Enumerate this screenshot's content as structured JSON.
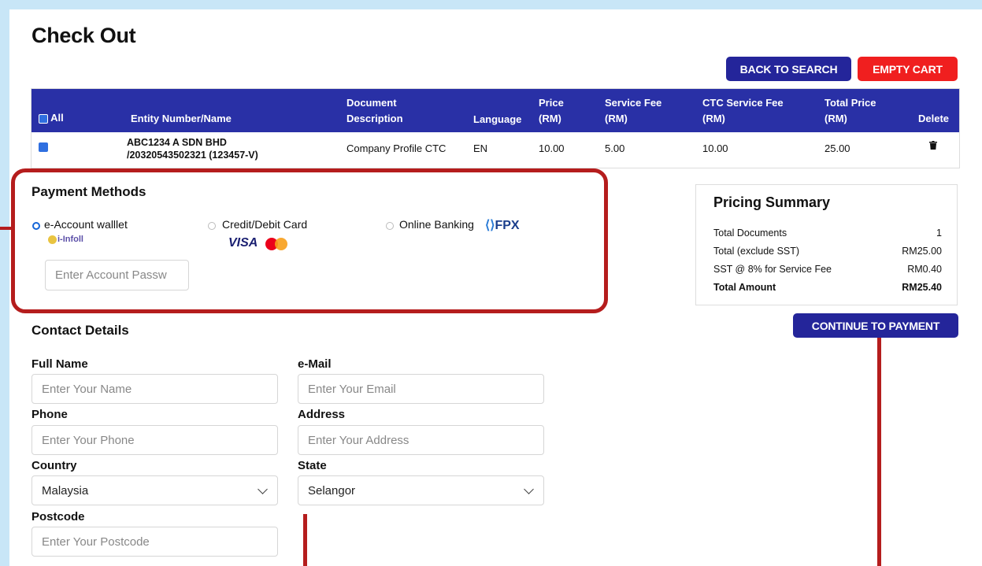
{
  "page": {
    "title": "Check Out"
  },
  "actions": {
    "back_label": "BACK TO SEARCH",
    "empty_label": "EMPTY CART",
    "continue_label": "CONTINUE TO PAYMENT"
  },
  "table": {
    "headers": {
      "all": "All",
      "entity": "Entity Number/Name",
      "doc_line1": "Document",
      "doc_line2": "Description",
      "language": "Language",
      "price_line1": "Price",
      "price_line2": "(RM)",
      "fee_line1": "Service Fee",
      "fee_line2": "(RM)",
      "ctc_line1": "CTC Service Fee",
      "ctc_line2": "(RM)",
      "total_line1": "Total Price",
      "total_line2": "(RM)",
      "delete": "Delete"
    },
    "row": {
      "entity_line1": "ABC1234 A SDN BHD",
      "entity_line2": "/20320543502321 (123457-V)",
      "description": "Company Profile CTC",
      "language": "EN",
      "price": "10.00",
      "service_fee": "5.00",
      "ctc_fee": "10.00",
      "total": "25.00",
      "checked": true
    }
  },
  "payment": {
    "title": "Payment Methods",
    "options": [
      {
        "label": "e-Account walllet",
        "logo": "i-Infoll",
        "selected": true
      },
      {
        "label": "Credit/Debit Card",
        "logo": "VISA",
        "selected": false
      },
      {
        "label": "Online Banking",
        "logo": "FPX",
        "selected": false
      }
    ],
    "password_placeholder": "Enter Account Passw"
  },
  "summary": {
    "title": "Pricing Summary",
    "rows": [
      {
        "label": "Total Documents",
        "value": "1"
      },
      {
        "label": "Total (exclude SST)",
        "value": "RM25.00"
      },
      {
        "label": "SST @ 8% for Service Fee",
        "value": "RM0.40"
      },
      {
        "label": "Total Amount",
        "value": "RM25.40"
      }
    ]
  },
  "contact": {
    "title": "Contact Details",
    "full_name_label": "Full Name",
    "full_name_placeholder": "Enter Your Name",
    "email_label": "e-Mail",
    "email_placeholder": "Enter Your Email",
    "phone_label": "Phone",
    "phone_placeholder": "Enter Your Phone",
    "address_label": "Address",
    "address_placeholder": "Enter Your Address",
    "country_label": "Country",
    "country_value": "Malaysia",
    "state_label": "State",
    "state_value": "Selangor",
    "postcode_label": "Postcode",
    "postcode_placeholder": "Enter Your Postcode"
  },
  "colors": {
    "primary": "#24259a",
    "danger": "#f01f1f",
    "annotation": "#b51d1d",
    "background": "#c8e6f7"
  }
}
